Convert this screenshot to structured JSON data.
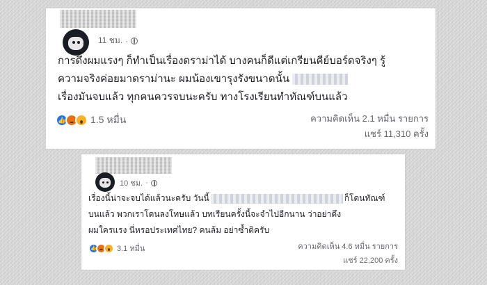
{
  "posts": [
    {
      "time": "11 ชม.",
      "dot": "·",
      "lines": [
        "การดึงผมแรงๆ ก็ทำเป็นเรื่องดราม่าได้ บางคนก็ดีแต่เกรียนคีย์บอร์ดจริงๆ รู้",
        "ความจริงค่อยมาดราม่านะ ผมน้องเขารุงรังขนาดนั้น",
        "เรื่องมันจบแล้ว ทุกคนควรจบนะครับ ทางโรงเรียนทำทัณฑ์บนแล้ว"
      ],
      "reaction_count": "1.5 หมื่น",
      "comments": "ความคิดเห็น 2.1 หมื่น รายการ",
      "shares": "แชร์ 11,310 ครั้ง"
    },
    {
      "time": "10 ชม.",
      "dot": "·",
      "line1_prefix": "เรื่องนี้น่าจะจบได้แล้วนะครับ วันนี้",
      "line1_suffix": "ก็โดนทัณฑ์",
      "line2": "บนแล้ว พวกเราโดนลงโทษแล้ว บทเรียนครั้งนี้จะจำไปอีกนาน ว่าอย่าดึง",
      "line3": "ผมใครแรง นี่หรอประเทศไทย? คนล้ม อย่าซ้ำดิครับ",
      "reaction_count": "3.1 หมื่น",
      "comments": "ความคิดเห็น 4.6 หมื่น รายการ",
      "shares": "แชร์ 22,200 ครั้ง"
    }
  ],
  "icons": {
    "privacy": "globe-icon",
    "reactions": [
      "like-icon",
      "angry-icon",
      "wow-icon"
    ]
  },
  "colors": {
    "like": "#1877f2",
    "angry": "#e9710f",
    "wow": "#f7b125",
    "text": "#1c1e21",
    "muted": "#65676b"
  }
}
